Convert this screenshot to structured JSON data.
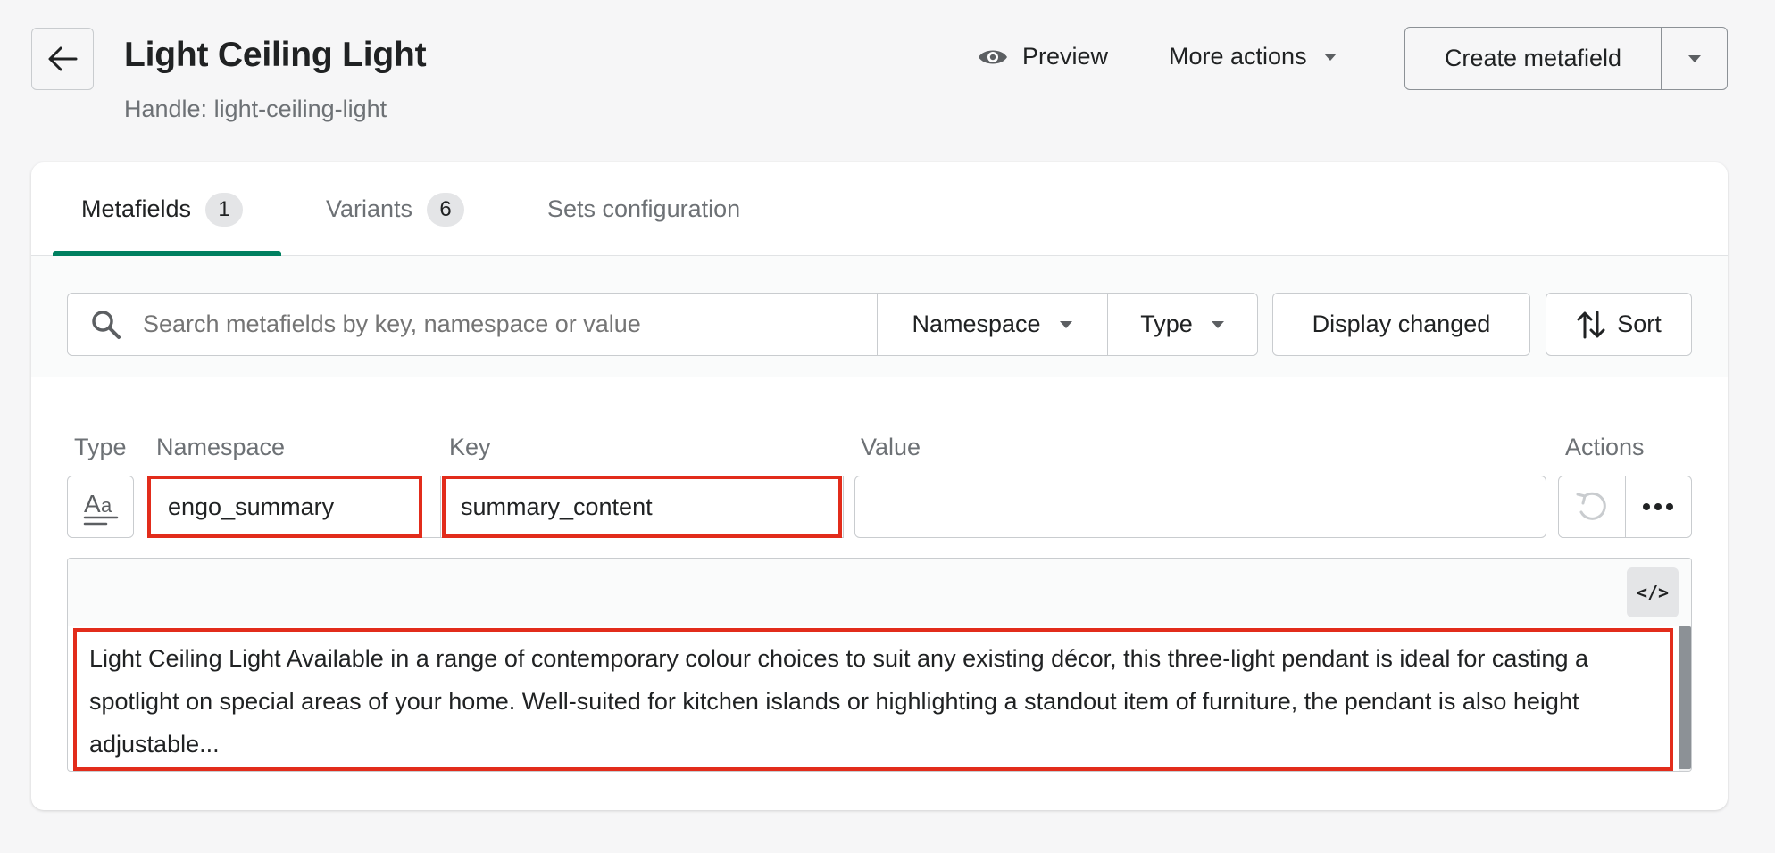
{
  "header": {
    "title": "Light Ceiling Light",
    "handle": "Handle: light-ceiling-light",
    "preview_label": "Preview",
    "more_actions_label": "More actions",
    "create_label": "Create metafield"
  },
  "tabs": [
    {
      "label": "Metafields",
      "badge": "1",
      "active": true
    },
    {
      "label": "Variants",
      "badge": "6",
      "active": false
    },
    {
      "label": "Sets configuration",
      "badge": "",
      "active": false
    }
  ],
  "filters": {
    "search_placeholder": "Search metafields by key, namespace or value",
    "namespace_label": "Namespace",
    "type_label": "Type",
    "display_changed_label": "Display changed",
    "sort_label": "Sort"
  },
  "table": {
    "headers": {
      "type": "Type",
      "namespace": "Namespace",
      "key": "Key",
      "value": "Value",
      "actions": "Actions"
    },
    "row": {
      "namespace": "engo_summary",
      "key": "summary_content",
      "value": ""
    }
  },
  "editor": {
    "code_label": "</>",
    "content": "Light Ceiling Light Available in a range of contemporary colour choices to suit any existing décor, this three-light pendant is ideal for casting a spotlight on special areas of your home. Well-suited for kitchen islands or highlighting a standout item of furniture, the pendant is also height adjustable..."
  },
  "icons": {
    "back": "arrow-left-icon",
    "preview": "eye-icon",
    "search": "search-icon",
    "sort": "sort-arrows-icon",
    "type": "text-type-icon",
    "undo": "undo-icon",
    "more": "more-horizontal-icon"
  },
  "colors": {
    "accent": "#008060",
    "highlight": "#e22c1b"
  }
}
